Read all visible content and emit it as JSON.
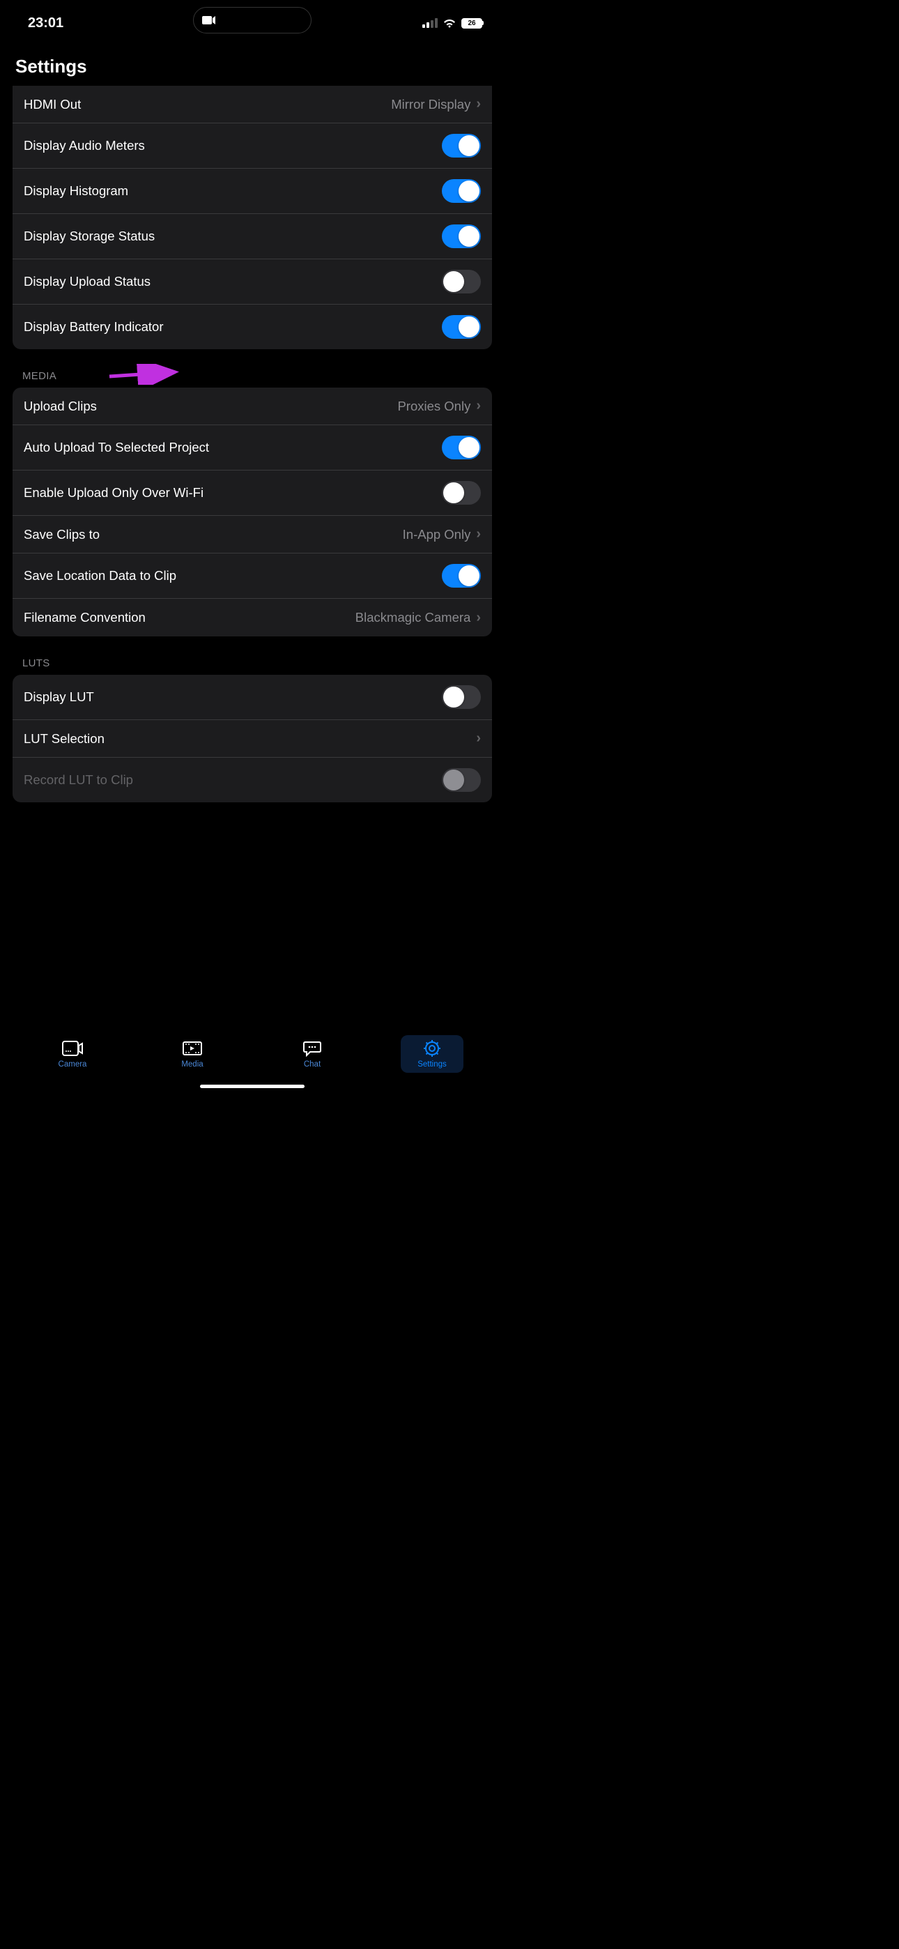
{
  "status": {
    "time": "23:01",
    "battery": "26"
  },
  "page": {
    "title": "Settings"
  },
  "sections": {
    "display": {
      "rows": {
        "hdmi_out": {
          "label": "HDMI Out",
          "value": "Mirror Display"
        },
        "audio_meters": {
          "label": "Display Audio Meters"
        },
        "histogram": {
          "label": "Display Histogram"
        },
        "storage_status": {
          "label": "Display Storage Status"
        },
        "upload_status": {
          "label": "Display Upload Status"
        },
        "battery_indicator": {
          "label": "Display Battery Indicator"
        }
      }
    },
    "media": {
      "header": "MEDIA",
      "rows": {
        "upload_clips": {
          "label": "Upload Clips",
          "value": "Proxies Only"
        },
        "auto_upload": {
          "label": "Auto Upload To Selected Project"
        },
        "wifi_only": {
          "label": "Enable Upload Only Over Wi-Fi"
        },
        "save_clips": {
          "label": "Save Clips to",
          "value": "In-App Only"
        },
        "location_data": {
          "label": "Save Location Data to Clip"
        },
        "filename": {
          "label": "Filename Convention",
          "value": "Blackmagic Camera"
        }
      }
    },
    "luts": {
      "header": "LUTS",
      "rows": {
        "display_lut": {
          "label": "Display LUT"
        },
        "lut_selection": {
          "label": "LUT Selection"
        },
        "record_lut": {
          "label": "Record LUT to Clip"
        }
      }
    }
  },
  "tabs": {
    "camera": "Camera",
    "media": "Media",
    "chat": "Chat",
    "settings": "Settings"
  },
  "toggles": {
    "audio_meters": true,
    "histogram": true,
    "storage_status": true,
    "upload_status": false,
    "battery_indicator": true,
    "auto_upload": true,
    "wifi_only": false,
    "location_data": true,
    "display_lut": false,
    "record_lut": false
  }
}
